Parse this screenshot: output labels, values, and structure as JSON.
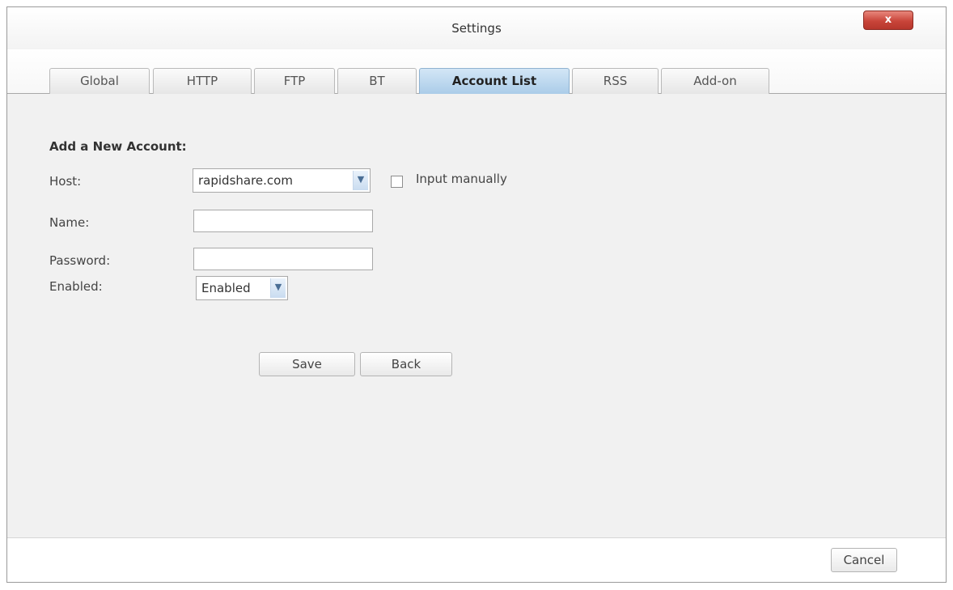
{
  "window": {
    "title": "Settings",
    "close_label": "x"
  },
  "tabs": [
    {
      "label": "Global"
    },
    {
      "label": "HTTP"
    },
    {
      "label": "FTP"
    },
    {
      "label": "BT"
    },
    {
      "label": "Account List",
      "active": true
    },
    {
      "label": "RSS"
    },
    {
      "label": "Add-on"
    }
  ],
  "form": {
    "section_title": "Add a New Account:",
    "host_label": "Host:",
    "host_value": "rapidshare.com",
    "input_manually_label": "Input manually",
    "input_manually_checked": false,
    "name_label": "Name:",
    "name_value": "",
    "password_label": "Password:",
    "password_value": "",
    "enabled_label": "Enabled:",
    "enabled_value": "Enabled",
    "save_label": "Save",
    "back_label": "Back"
  },
  "footer": {
    "cancel_label": "Cancel"
  },
  "icons": {
    "dropdown": "chevron-down-icon",
    "close": "close-icon"
  },
  "colors": {
    "active_tab": "#a9cbe8",
    "close_button": "#c9453a",
    "background": "#f1f1f1"
  }
}
